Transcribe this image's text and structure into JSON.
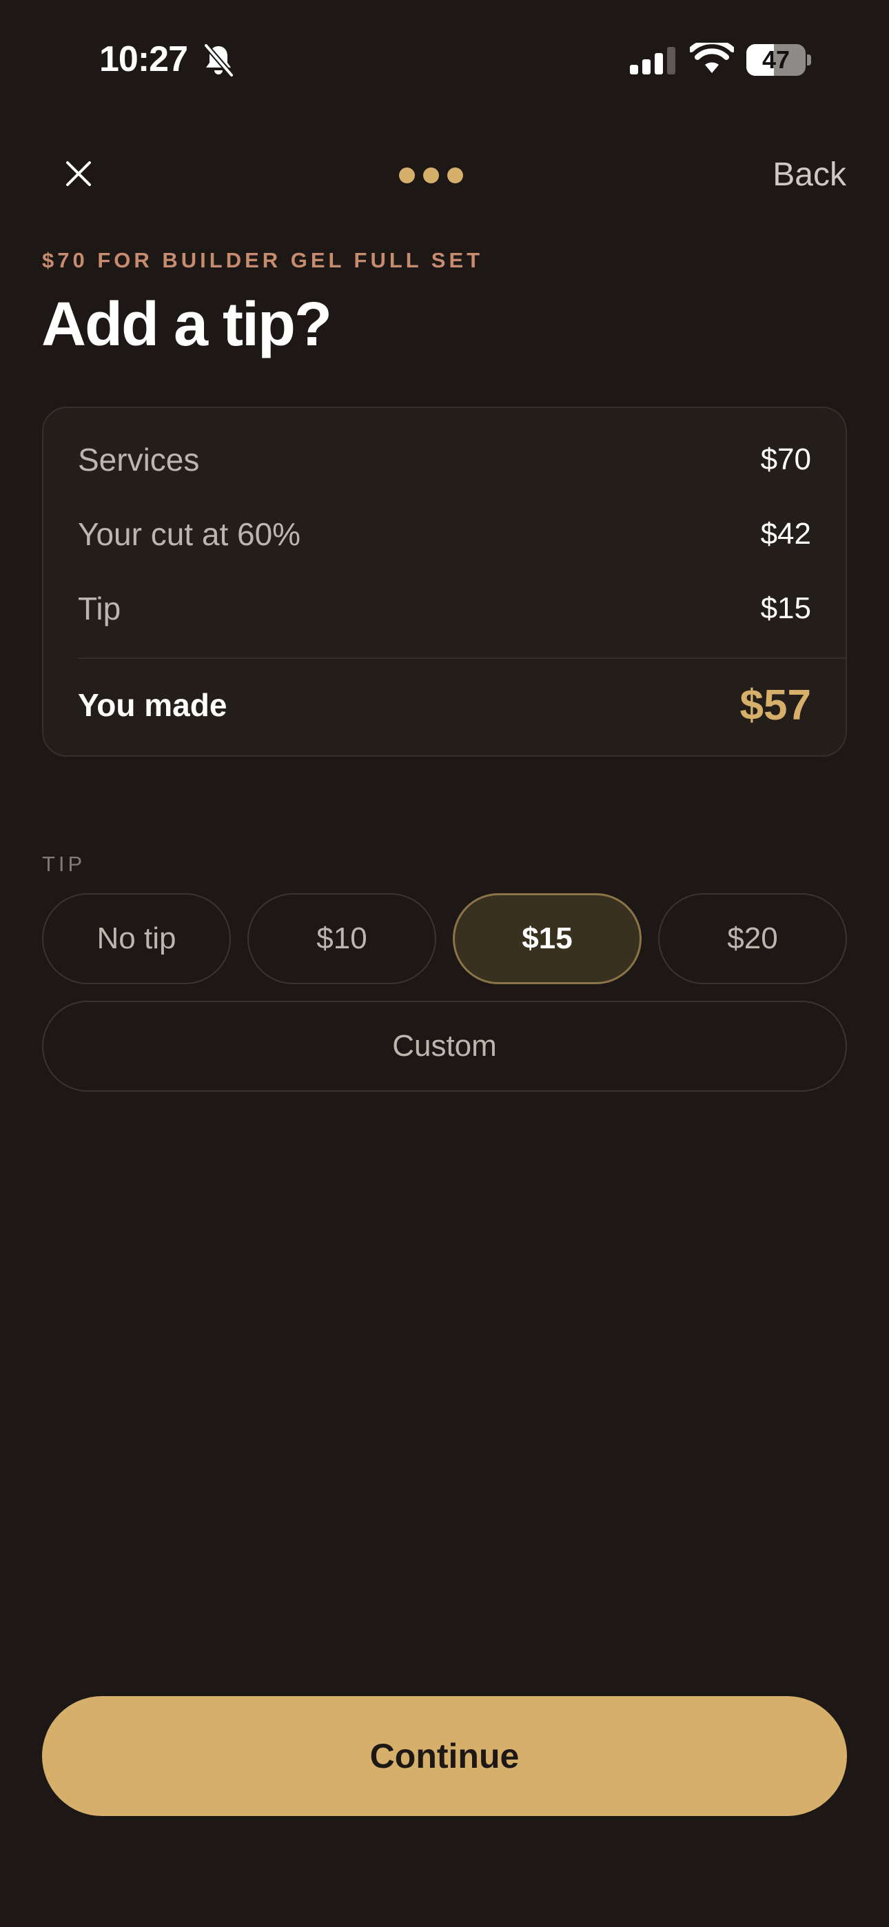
{
  "status_bar": {
    "time": "10:27",
    "battery_level": "47",
    "battery_fraction": 0.47
  },
  "nav": {
    "close_icon": "close-icon",
    "progress_dots": 3,
    "back_label": "Back"
  },
  "header": {
    "eyebrow": "$70 FOR BUILDER GEL FULL SET",
    "title": "Add a tip?"
  },
  "summary": {
    "rows": [
      {
        "label": "Services",
        "value": "$70"
      },
      {
        "label": "Your cut at 60%",
        "value": "$42"
      },
      {
        "label": "Tip",
        "value": "$15"
      }
    ],
    "total_label": "You made",
    "total_value": "$57"
  },
  "tip": {
    "section_label": "TIP",
    "options": [
      "No tip",
      "$10",
      "$15",
      "$20"
    ],
    "selected": "$15",
    "custom_label": "Custom"
  },
  "footer": {
    "continue_label": "Continue"
  },
  "colors": {
    "background": "#1d1816",
    "card": "#231e1a",
    "accent": "#d6b06a",
    "eyebrow": "#c78b6f",
    "selected_chip": "#39311f"
  }
}
